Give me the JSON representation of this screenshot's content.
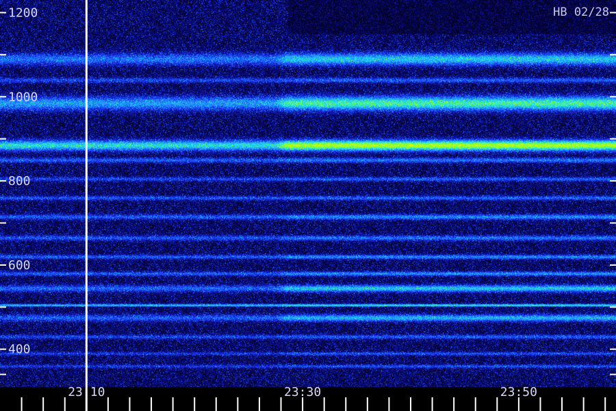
{
  "chart_data": {
    "type": "heatmap",
    "title": "",
    "xlabel": "",
    "ylabel": "",
    "tag": "HB 02/28",
    "ylim": [
      310,
      1230
    ],
    "y_ticks_labeled": [
      {
        "value": 400,
        "label": "400"
      },
      {
        "value": 600,
        "label": "600"
      },
      {
        "value": 800,
        "label": "800"
      },
      {
        "value": 1000,
        "label": "1000"
      },
      {
        "value": 1200,
        "label": "1200"
      }
    ],
    "y_minor_ticks": [
      340,
      500,
      700,
      900,
      1100
    ],
    "x_range_minutes": [
      "23:02",
      "23:59"
    ],
    "x_ticks_labeled": [
      {
        "time": "23:10",
        "label": "23:10"
      },
      {
        "time": "23:30",
        "label": "23:30"
      },
      {
        "time": "23:50",
        "label": "23:50"
      }
    ],
    "x_minor_ticks": [
      "23:04",
      "23:06",
      "23:08",
      "23:12",
      "23:14",
      "23:16",
      "23:18",
      "23:20",
      "23:22",
      "23:24",
      "23:26",
      "23:28",
      "23:32",
      "23:34",
      "23:36",
      "23:38",
      "23:40",
      "23:42",
      "23:44",
      "23:46",
      "23:48",
      "23:52",
      "23:54",
      "23:56",
      "23:58"
    ],
    "marker_time": "23:10",
    "change_time": "23:28",
    "bands": [
      {
        "center": 1090,
        "halfwidth": 14,
        "before": 0.35,
        "after": 0.55
      },
      {
        "center": 1040,
        "halfwidth": 6,
        "before": 0.25,
        "after": 0.3
      },
      {
        "center": 985,
        "halfwidth": 16,
        "before": 0.45,
        "after": 0.72
      },
      {
        "center": 885,
        "halfwidth": 12,
        "before": 0.62,
        "after": 0.95
      },
      {
        "center": 850,
        "halfwidth": 6,
        "before": 0.3,
        "after": 0.35
      },
      {
        "center": 805,
        "halfwidth": 5,
        "before": 0.25,
        "after": 0.3
      },
      {
        "center": 760,
        "halfwidth": 5,
        "before": 0.28,
        "after": 0.32
      },
      {
        "center": 715,
        "halfwidth": 6,
        "before": 0.3,
        "after": 0.4
      },
      {
        "center": 665,
        "halfwidth": 6,
        "before": 0.28,
        "after": 0.35
      },
      {
        "center": 620,
        "halfwidth": 5,
        "before": 0.3,
        "after": 0.4
      },
      {
        "center": 580,
        "halfwidth": 5,
        "before": 0.3,
        "after": 0.42
      },
      {
        "center": 545,
        "halfwidth": 8,
        "before": 0.32,
        "after": 0.55
      },
      {
        "center": 505,
        "halfwidth": 3,
        "before": 0.55,
        "after": 0.65
      },
      {
        "center": 475,
        "halfwidth": 8,
        "before": 0.3,
        "after": 0.5
      },
      {
        "center": 430,
        "halfwidth": 5,
        "before": 0.25,
        "after": 0.3
      },
      {
        "center": 390,
        "halfwidth": 4,
        "before": 0.22,
        "after": 0.28
      },
      {
        "center": 360,
        "halfwidth": 4,
        "before": 0.22,
        "after": 0.28
      }
    ],
    "colormap": [
      "#000010",
      "#0a0a8c",
      "#1e3cff",
      "#1ea0ff",
      "#1ee6e6",
      "#78ff3c",
      "#dcff00"
    ]
  }
}
